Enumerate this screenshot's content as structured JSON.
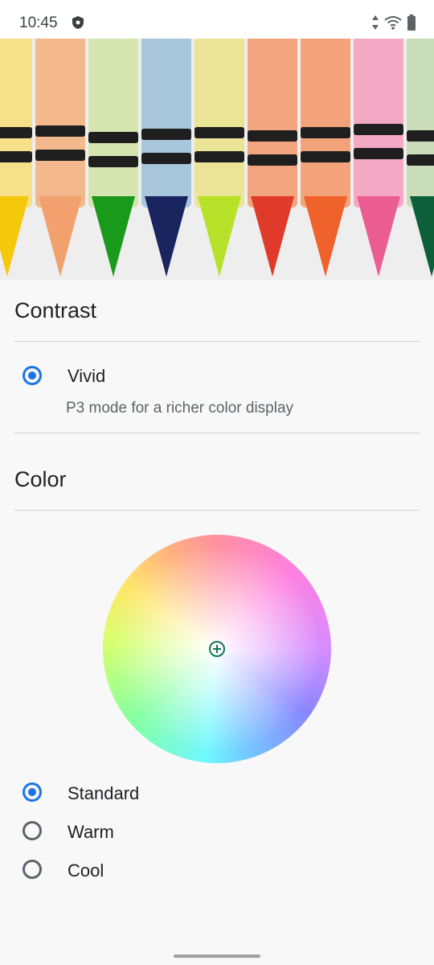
{
  "status_bar": {
    "time": "10:45",
    "icons": [
      "shield-icon",
      "data-arrows-icon",
      "wifi-icon",
      "battery-icon"
    ]
  },
  "hero": {
    "image": "crayons-photo"
  },
  "contrast": {
    "title": "Contrast",
    "options": [
      {
        "label": "Vivid",
        "description": "P3 mode for a richer color display",
        "selected": true
      }
    ]
  },
  "color": {
    "title": "Color",
    "wheel": "color-temperature-wheel",
    "options": [
      {
        "label": "Standard",
        "selected": true
      },
      {
        "label": "Warm",
        "selected": false
      },
      {
        "label": "Cool",
        "selected": false
      }
    ]
  },
  "colors": {
    "accent": "#1a73e8",
    "background": "#f8f8f8",
    "divider": "#cfcfcf"
  }
}
